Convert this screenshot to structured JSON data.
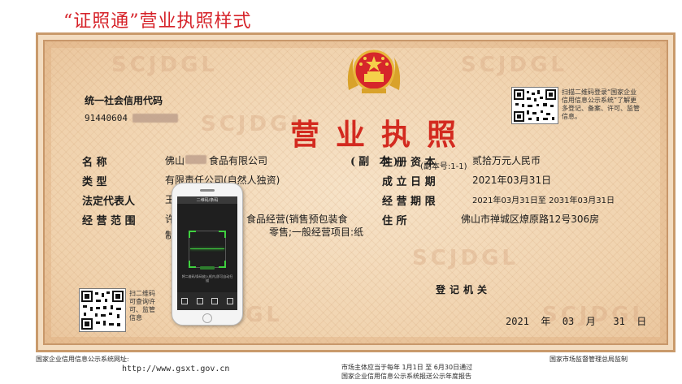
{
  "heading": "“证照通”营业执照样式",
  "license": {
    "title": "营业执照",
    "copy_label": "(副 本)",
    "copy_no": "(副本号:1-1)",
    "watermark": "SCJDGL",
    "credit_label": "统一社会信用代码",
    "credit_code": "91440604",
    "fields_left": [
      {
        "label": "名          称",
        "value": "佛山",
        "value_tail": "食品有限公司"
      },
      {
        "label": "类          型",
        "value": "有限责任公司(自然人独资)"
      },
      {
        "label": "法定代表人",
        "value": "王"
      },
      {
        "label": "经  营  范  围",
        "value": "许",
        "value_line2": "制",
        "value_right1": "食品经营(销售预包装食",
        "value_right2": "零售;一般经营项目:纸"
      }
    ],
    "fields_right": [
      {
        "label": "注  册  资  本",
        "value": "贰拾万元人民币"
      },
      {
        "label": "成  立  日  期",
        "value": "2021年03月31日"
      },
      {
        "label": "经  营  期  限",
        "value": "2021年03月31日至  2031年03月31日"
      },
      {
        "label": "住              所",
        "value": "佛山市禅城区燎原路12号306房"
      }
    ],
    "qr_top_note": "扫描二维码登录“国家企业信用信息公示系统”了解更多登记、备案、许可、监管信息。",
    "qr_bottom_note": "扫二维码可查询许可、监管信息",
    "registration_office": "登记机关",
    "registration_date": "2021  年  03  月   31  日"
  },
  "phone": {
    "scan_title": "二维码/条码",
    "scan_hint": "将二维码/条码放入框内,即可自动扫描"
  },
  "footer": {
    "left_label": "国家企业信用信息公示系统网址:",
    "left_url": "http://www.gsxt.gov.cn",
    "middle_line1": "市场主体应当于每年 1月1日 至 6月30日通过",
    "middle_line2": "国家企业信用信息公示系统报送公示年度报告",
    "right_label": "国家市场监督管理总局监制"
  },
  "colors": {
    "heading": "#d6232a",
    "title": "#d32a1f",
    "paper": "#f0d2ad",
    "border": "#c99a6b"
  }
}
